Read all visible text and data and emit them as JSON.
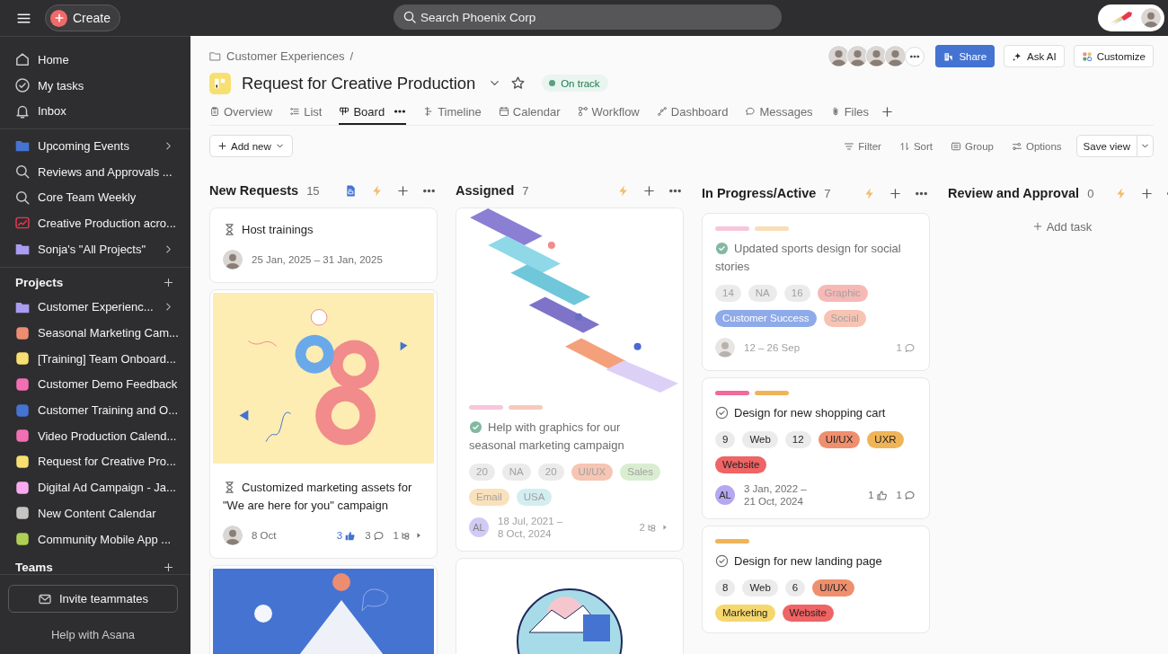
{
  "topbar": {
    "create": "Create",
    "search": {
      "placeholder": "Search Phoenix Corp"
    }
  },
  "sidebar": {
    "nav": [
      {
        "label": "Home"
      },
      {
        "label": "My tasks"
      },
      {
        "label": "Inbox"
      }
    ],
    "shortcuts": [
      {
        "label": "Upcoming Events",
        "kind": "folder",
        "color": "#4573d2",
        "has_children": true
      },
      {
        "label": "Reviews and Approvals ...",
        "kind": "search",
        "has_children": false
      },
      {
        "label": "Core Team Weekly",
        "kind": "search",
        "has_children": false
      },
      {
        "label": "Creative Production acro...",
        "kind": "chart",
        "color": "#e8384f",
        "has_children": false
      },
      {
        "label": "Sonja's \"All Projects\"",
        "kind": "folder",
        "color": "#a99cf1",
        "has_children": true
      }
    ],
    "projects_heading": "Projects",
    "projects": [
      {
        "label": "Customer Experienc...",
        "kind": "folder",
        "color": "#a99cf1",
        "has_children": true
      },
      {
        "label": "Seasonal Marketing Cam...",
        "kind": "square",
        "color": "#ec8d71",
        "has_children": false
      },
      {
        "label": "[Training] Team Onboard...",
        "kind": "square",
        "color": "#f8df72",
        "has_children": false
      },
      {
        "label": "Customer Demo Feedback",
        "kind": "square",
        "color": "#f26fb2",
        "has_children": false
      },
      {
        "label": "Customer Training and O...",
        "kind": "square",
        "color": "#4573d2",
        "has_children": false
      },
      {
        "label": "Video Production Calend...",
        "kind": "square",
        "color": "#f26fb2",
        "has_children": false
      },
      {
        "label": "Request for Creative Pro...",
        "kind": "square",
        "color": "#f8df72",
        "has_children": false
      },
      {
        "label": "Digital Ad Campaign - Ja...",
        "kind": "square",
        "color": "#f9aaef",
        "has_children": false
      },
      {
        "label": "New Content Calendar",
        "kind": "square",
        "color": "#c7c4c4",
        "has_children": false
      },
      {
        "label": "Community Mobile App ...",
        "kind": "square",
        "color": "#aecf55",
        "has_children": false
      }
    ],
    "teams_heading": "Teams",
    "invite": "Invite teammates",
    "help": "Help with Asana"
  },
  "header": {
    "breadcrumb": "Customer Experiences",
    "separator": "/",
    "title": "Request for Creative Production",
    "status": "On track",
    "members": [
      {
        "kind": "photo"
      },
      {
        "kind": "photo"
      },
      {
        "kind": "photo"
      },
      {
        "kind": "photo"
      }
    ],
    "share": "Share",
    "ask_ai": "Ask AI",
    "customize": "Customize",
    "tabs": [
      {
        "label": "Overview",
        "selected": false
      },
      {
        "label": "List",
        "selected": false
      },
      {
        "label": "Board",
        "selected": true
      },
      {
        "label": "Timeline",
        "selected": false
      },
      {
        "label": "Calendar",
        "selected": false
      },
      {
        "label": "Workflow",
        "selected": false
      },
      {
        "label": "Dashboard",
        "selected": false
      },
      {
        "label": "Messages",
        "selected": false
      },
      {
        "label": "Files",
        "selected": false
      }
    ]
  },
  "toolbar": {
    "add_new": "Add new",
    "actions": [
      {
        "label": "Filter"
      },
      {
        "label": "Sort"
      },
      {
        "label": "Group"
      },
      {
        "label": "Options"
      }
    ],
    "save_view": "Save view"
  },
  "columns": [
    {
      "title": "New Requests",
      "count": "15",
      "has_form": true,
      "cards": [
        {
          "kind": "milestone",
          "has_cover": false,
          "completed": false,
          "title": "Host trainings",
          "assignee": {
            "kind": "photo"
          },
          "date": [
            "25 Jan, 2025 – 31 Jan, 2025"
          ]
        },
        {
          "kind": "milestone",
          "has_cover": true,
          "completed": false,
          "title": "Customized marketing assets for \"We are here for you\" campaign",
          "assignee": {
            "kind": "photo"
          },
          "date": [
            "8 Oct"
          ],
          "likes": "3",
          "liked": true,
          "comments": "3",
          "subtasks": "1"
        },
        {
          "kind": "cover",
          "has_cover": true,
          "completed": false
        }
      ]
    },
    {
      "title": "Assigned",
      "count": "7",
      "has_form": false,
      "cards": [
        {
          "kind": "task",
          "has_cover": true,
          "completed": true,
          "bars": [
            {
              "color": "#f8c6dc"
            },
            {
              "color": "#f6cabb"
            }
          ],
          "title": "Help with graphics for our seasonal marketing campaign",
          "tags": [
            {
              "label": "20"
            },
            {
              "label": "NA"
            },
            {
              "label": "20"
            },
            {
              "label": "UI/UX",
              "color": "#f6c5b3"
            },
            {
              "label": "Sales",
              "color": "#d9eed0"
            },
            {
              "label": "Email",
              "color": "#f9e1bb"
            },
            {
              "label": "USA",
              "color": "#d3eef0"
            }
          ],
          "assignee": {
            "kind": "initials",
            "text": "AL"
          },
          "date": [
            "18 Jul, 2021 –",
            "8 Oct, 2024"
          ],
          "subtasks": "2"
        },
        {
          "kind": "cover",
          "has_cover": true,
          "completed": false
        }
      ]
    },
    {
      "title": "In Progress/Active",
      "count": "7",
      "has_form": false,
      "cards": [
        {
          "kind": "task",
          "has_cover": false,
          "completed": true,
          "bars": [
            {
              "color": "#f8c6dc"
            },
            {
              "color": "#f8deb8"
            }
          ],
          "title": "Updated sports design for social stories",
          "tags": [
            {
              "label": "14"
            },
            {
              "label": "NA"
            },
            {
              "label": "16"
            },
            {
              "label": "Graphic",
              "color": "#f7b9b6"
            },
            {
              "label": "Customer Success",
              "color": "#8eaae8",
              "light_text": true
            },
            {
              "label": "Social",
              "color": "#f7c3b3"
            }
          ],
          "assignee": {
            "kind": "photo"
          },
          "date": [
            "12 – 26 Sep"
          ],
          "comments": "1"
        },
        {
          "kind": "task",
          "has_cover": false,
          "completed": false,
          "bars": [
            {
              "color": "#f06a9c"
            },
            {
              "color": "#f0b458"
            }
          ],
          "title": "Design for new shopping cart",
          "tags": [
            {
              "label": "9"
            },
            {
              "label": "Web"
            },
            {
              "label": "12"
            },
            {
              "label": "UI/UX",
              "color": "#ef8f6e"
            },
            {
              "label": "UXR",
              "color": "#f0b458"
            },
            {
              "label": "Website",
              "color": "#ef6464"
            }
          ],
          "assignee": {
            "kind": "initials",
            "text": "AL"
          },
          "date": [
            "3 Jan, 2022 –",
            "21 Oct, 2024"
          ],
          "likes": "1",
          "liked": false,
          "comments": "1"
        },
        {
          "kind": "task",
          "has_cover": false,
          "completed": false,
          "bars": [
            {
              "color": "#f0b458"
            }
          ],
          "title": "Design for new landing page",
          "tags": [
            {
              "label": "8"
            },
            {
              "label": "Web"
            },
            {
              "label": "6"
            },
            {
              "label": "UI/UX",
              "color": "#ef8f6e"
            },
            {
              "label": "Marketing",
              "color": "#f5d76e"
            },
            {
              "label": "Website",
              "color": "#ef6464"
            }
          ]
        }
      ]
    },
    {
      "title": "Review and Approval",
      "count": "0",
      "has_form": false,
      "add_task": "Add task"
    }
  ]
}
